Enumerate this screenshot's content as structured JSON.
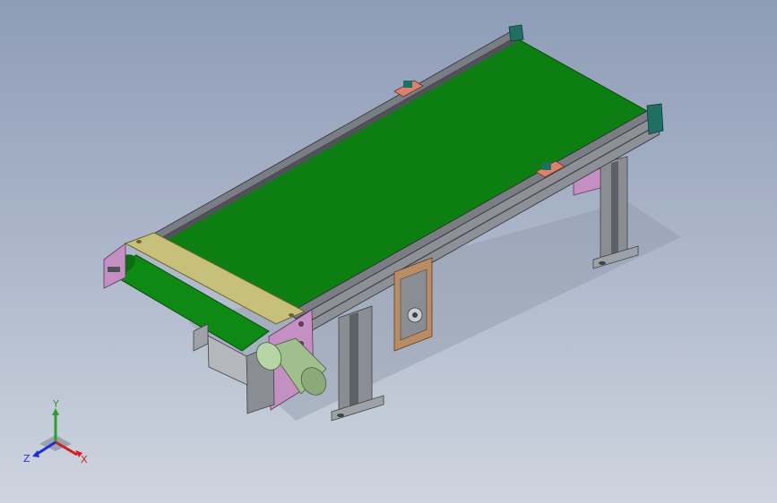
{
  "viewport": {
    "background_top": "#8e9cb6",
    "background_bottom": "#cfd5df"
  },
  "model": {
    "name": "belt-conveyor-assembly",
    "belt_color": "#0d7f12",
    "frame_color": "#6f7378",
    "end_plate_color": "#c6c07a",
    "motor_color": "#9fbf8c",
    "bracket_color": "#b98c64",
    "side_plate_color": "#c48fc2",
    "clamp_color": "#d9826f"
  },
  "triad": {
    "x_label": "X",
    "y_label": "Y",
    "z_label": "Z",
    "x_color": "#d11f1f",
    "y_color": "#2aa02a",
    "z_color": "#1f2fd1"
  }
}
